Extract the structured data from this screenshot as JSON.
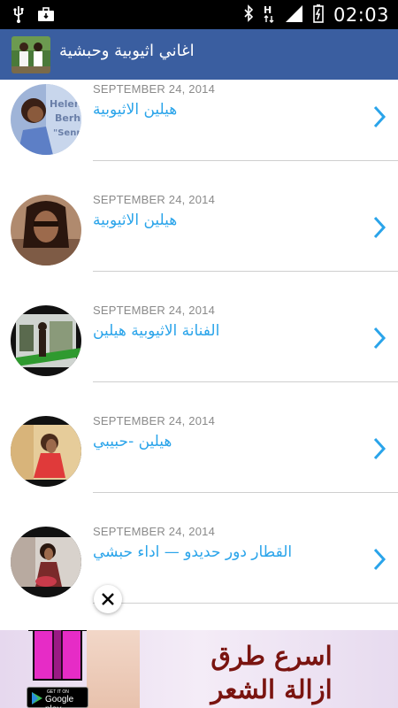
{
  "status_bar": {
    "time": "02:03"
  },
  "app": {
    "title": "اغاني اثيوبية وحبشية"
  },
  "list": [
    {
      "date": "SEPTEMBER 24, 2014",
      "title": "هيلين الاثيوبية"
    },
    {
      "date": "SEPTEMBER 24, 2014",
      "title": "هيلين الاثيوبية"
    },
    {
      "date": "SEPTEMBER 24, 2014",
      "title": "الفنانة الاثيوبية هيلين"
    },
    {
      "date": "SEPTEMBER 24, 2014",
      "title": "هيلين -حبيبي"
    },
    {
      "date": "SEPTEMBER 24, 2014",
      "title": "القطار دور حديدو — اداء حبشي"
    }
  ],
  "thumb_texts": {
    "row0": [
      "Helen",
      "Berh",
      "\"Senn"
    ]
  },
  "ad": {
    "line1": "اسرع طرق",
    "line2": "ازالة الشعر",
    "store_small": "GET IT ON",
    "store_big": "Google play"
  },
  "colors": {
    "action_bar": "#3a5ea0",
    "title_text": "#2aa4ea",
    "date_text": "#8a8a8a"
  }
}
